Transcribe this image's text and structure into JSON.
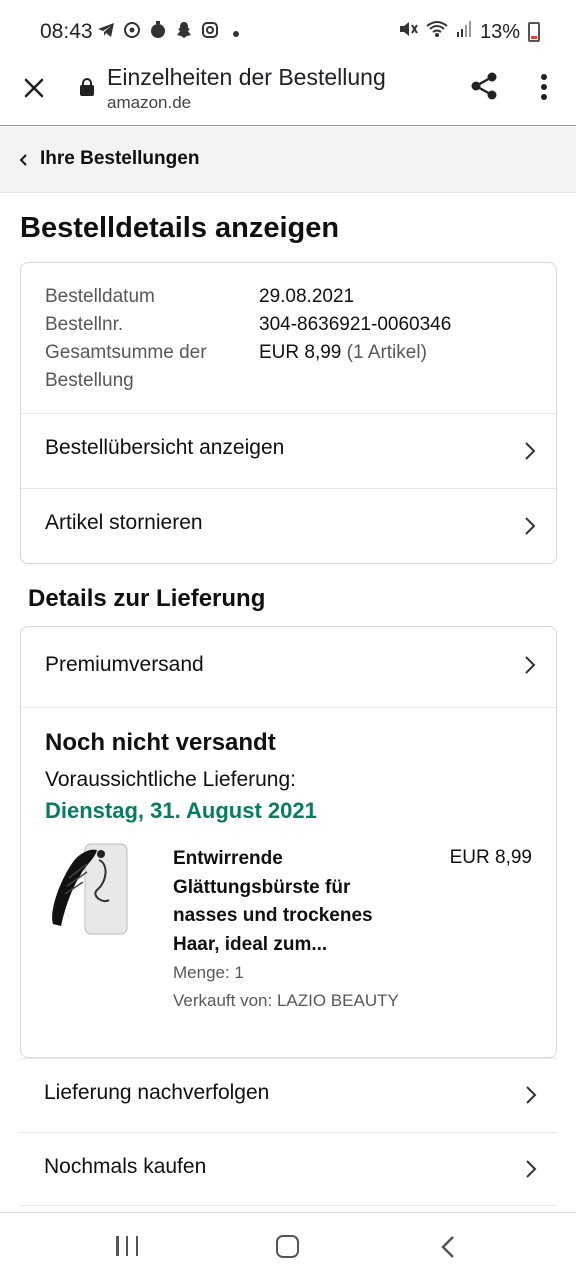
{
  "status_bar": {
    "time": "08:43",
    "left_icons": [
      "telegram-icon",
      "whatsapp-icon",
      "timer-icon",
      "snapchat-icon",
      "instagram-icon",
      "dot-icon"
    ],
    "battery": "13%",
    "right_icons": [
      "mute-icon",
      "wifi-icon",
      "signal-icon",
      "battery-icon"
    ]
  },
  "browser": {
    "title": "Einzelheiten der Bestellung",
    "url": "amazon.de"
  },
  "breadcrumb": {
    "label": "Ihre Bestellungen"
  },
  "page": {
    "title": "Bestelldetails anzeigen"
  },
  "order_summary": {
    "date_label": "Bestelldatum",
    "date_value": "29.08.2021",
    "number_label": "Bestellnr.",
    "number_value": "304-8636921-0060346",
    "total_label_line1": "Gesamtsumme der",
    "total_label_line2": "Bestellung",
    "total_value": "EUR 8,99",
    "total_items": "(1 Artikel)",
    "actions": [
      {
        "label": "Bestellübersicht anzeigen"
      },
      {
        "label": "Artikel stornieren"
      }
    ]
  },
  "delivery": {
    "section_title": "Details zur Lieferung",
    "shipping_method": "Premiumversand",
    "status": "Noch nicht versandt",
    "expected_label": "Voraussichtliche Lieferung:",
    "expected_date": "Dienstag, 31. August 2021",
    "date_color": "#067d62",
    "item": {
      "title": "Entwirrende Glättungsbürste für nasses und trockenes Haar, ideal zum...",
      "price": "EUR 8,99",
      "quantity": "Menge: 1",
      "seller": "Verkauft von: LAZIO BEAUTY"
    }
  },
  "more_actions": [
    {
      "label": "Lieferung nachverfolgen"
    },
    {
      "label": "Nochmals kaufen"
    }
  ],
  "nav_bar": {
    "icons": [
      "recents-icon",
      "home-icon",
      "back-icon"
    ]
  }
}
